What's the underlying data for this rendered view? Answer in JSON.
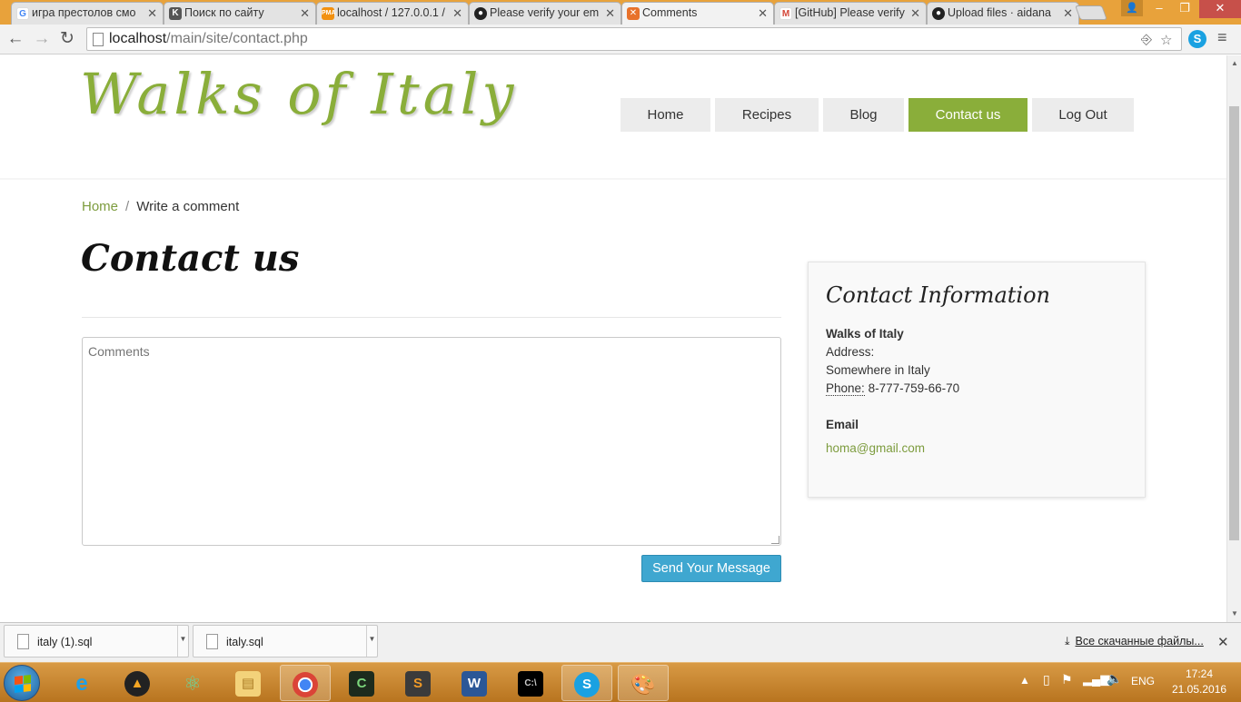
{
  "browser": {
    "tabs": [
      {
        "title": "игра престолов смо",
        "favicon": "google-icon",
        "active": false
      },
      {
        "title": "Поиск по сайту",
        "favicon": "k-site-icon",
        "active": false
      },
      {
        "title": "localhost / 127.0.0.1 /",
        "favicon": "phpmyadmin-icon",
        "active": false
      },
      {
        "title": "Please verify your em",
        "favicon": "github-icon",
        "active": false
      },
      {
        "title": "Comments",
        "favicon": "xampp-icon",
        "active": true
      },
      {
        "title": "[GitHub] Please verify",
        "favicon": "gmail-icon",
        "active": false
      },
      {
        "title": "Upload files · aidana",
        "favicon": "github-icon",
        "active": false
      }
    ],
    "url_host": "localhost",
    "url_path": "/main/site/contact.php"
  },
  "site": {
    "logo": "Walks of Italy",
    "nav": [
      {
        "label": "Home",
        "active": false
      },
      {
        "label": "Recipes",
        "active": false
      },
      {
        "label": "Blog",
        "active": false
      },
      {
        "label": "Contact us",
        "active": true
      },
      {
        "label": "Log Out",
        "active": false
      }
    ],
    "accent_color": "#8aae3a"
  },
  "breadcrumb": {
    "home": "Home",
    "separator": "/",
    "current": "Write a comment"
  },
  "page_title": "Contact us",
  "form": {
    "comments_placeholder": "Comments",
    "submit_label": "Send Your Message",
    "button_color": "#3fa7d0"
  },
  "contact": {
    "title": "Contact Information",
    "company": "Walks of Italy",
    "address_label": "Address:",
    "address": "Somewhere in Italy",
    "phone_label": "Phone:",
    "phone": "8-777-759-66-70",
    "email_heading": "Email",
    "email": "homa@gmail.com"
  },
  "downloads": {
    "items": [
      "italy (1).sql",
      "italy.sql"
    ],
    "all_label": "Все скачанные файлы..."
  },
  "taskbar": {
    "apps": [
      "internet-explorer-icon",
      "aimp-icon",
      "atom-icon",
      "file-explorer-icon",
      "chrome-icon",
      "terminal-icon",
      "sublime-text-icon",
      "word-icon",
      "cmd-icon",
      "skype-icon",
      "paint-icon"
    ],
    "language": "ENG",
    "time": "17:24",
    "date": "21.05.2016"
  }
}
